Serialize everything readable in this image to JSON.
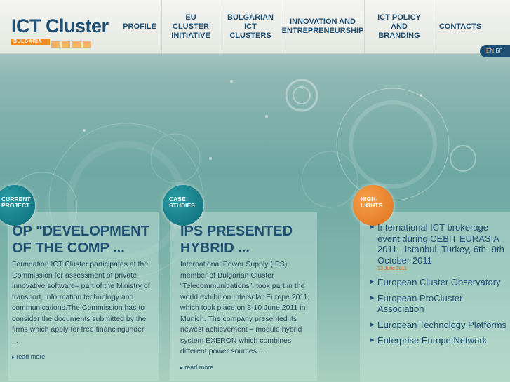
{
  "logo": {
    "title": "ICT Cluster",
    "subtitle": "BULGARIA"
  },
  "nav": [
    {
      "label": "PROFILE"
    },
    {
      "label": "EU CLUSTER\nINITIATIVE"
    },
    {
      "label": "BULGARIAN\nICT CLUSTERS"
    },
    {
      "label": "INNOVATION AND\nENTREPRENEURSHIP"
    },
    {
      "label": "ICT POLICY\nAND BRANDING"
    },
    {
      "label": "CONTACTS"
    }
  ],
  "lang": {
    "en": "EN",
    "bg": "БГ"
  },
  "cards": [
    {
      "badge": "CURRENT\nPROJECT",
      "title": "OP \"DEVELOPMENT OF THE COMP ...",
      "text": "Foundation ICT Cluster participates at the Commission for assessment of private innovative software– part of the Ministry of transport, information technology and communications.The Commission has to consider the documents submitted by the firms which apply for free financingunder ...",
      "read_more": "read more"
    },
    {
      "badge": "CASE\nSTUDIES",
      "title": "IPS PRESENTED HYBRID ...",
      "text": "International Power Supply (IPS), member of Bulgarian Cluster “Telecommunications”, took part in the world exhibition Intersolar Europe 2011, which took place on 8-10 June 2011 in Munich. The company  presented its newest achievement – module hybrid system EXERON which combines different power sources ...",
      "read_more": "read more"
    }
  ],
  "highlights": {
    "badge": "HIGH-\nLIGHTS",
    "items": [
      {
        "label": "International ICT brokerage event during CEBIT EURASIA 2011 , Istanbul, Turkey, 6th -9th October 2011",
        "date": "13 June 2011"
      },
      {
        "label": "European Cluster Observatory",
        "date": ""
      },
      {
        "label": "European ProCluster Association",
        "date": ""
      },
      {
        "label": "European Technology Platforms",
        "date": ""
      },
      {
        "label": "Enterprise Europe Network",
        "date": ""
      }
    ]
  }
}
